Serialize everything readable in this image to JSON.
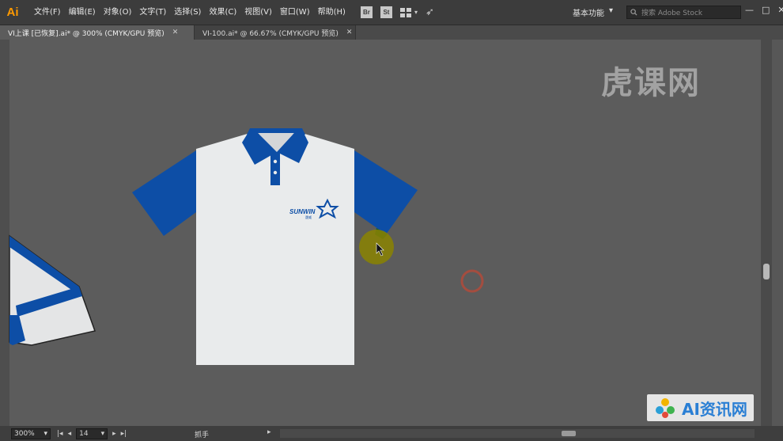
{
  "app": {
    "logo": "Ai",
    "menu": [
      "文件(F)",
      "编辑(E)",
      "对象(O)",
      "文字(T)",
      "选择(S)",
      "效果(C)",
      "视图(V)",
      "窗口(W)",
      "帮助(H)"
    ],
    "bridge_label": "Br",
    "stock_label": "St",
    "workspace_label": "基本功能",
    "search_placeholder": "搜索 Adobe Stock",
    "window_controls": [
      "—",
      "□",
      "✕"
    ]
  },
  "tabs": [
    {
      "label": "VI上课 [已恢复].ai* @ 300% (CMYK/GPU 预览)",
      "active": true
    },
    {
      "label": "VI-100.ai* @ 66.67% (CMYK/GPU 预览)",
      "active": false
    }
  ],
  "artwork": {
    "logo_text": "SUNWIN",
    "logo_subtext": "晟威",
    "shirt_color": "#e9ebec",
    "accent_color": "#0d4ea6"
  },
  "watermarks": {
    "top_right": "虎课网",
    "bottom_right": "AI资讯网"
  },
  "status": {
    "zoom": "300%",
    "page": "14",
    "tool": "抓手"
  },
  "icons": {
    "search": "search-icon",
    "caret": "chevron-down-icon"
  }
}
